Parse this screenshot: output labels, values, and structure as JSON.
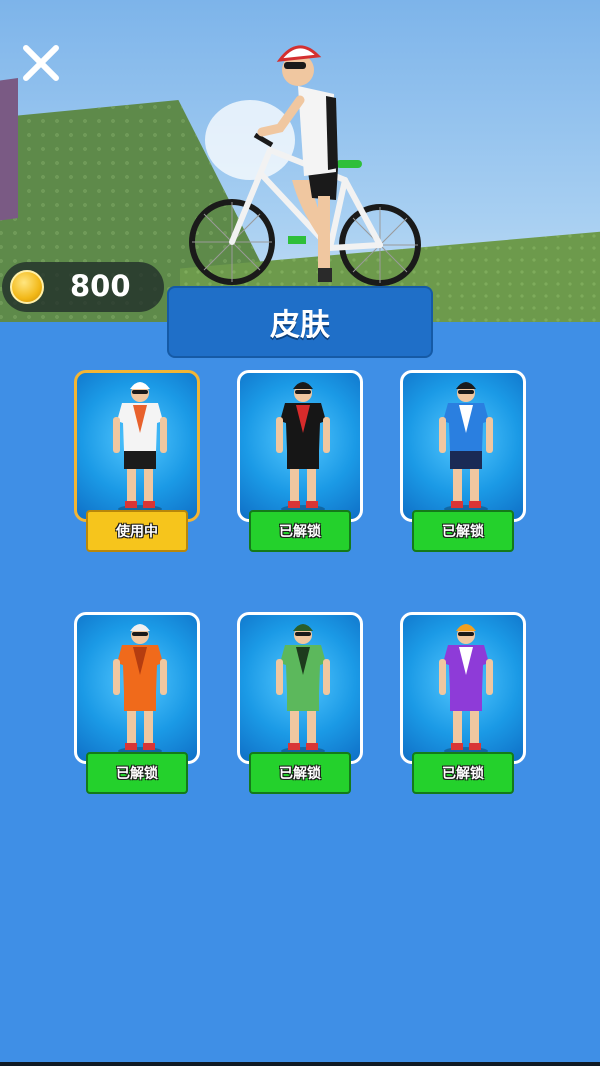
{
  "currency": {
    "amount": "800",
    "icon": "coin-icon"
  },
  "title": "皮肤",
  "colors": {
    "panel": "#3f8fe6",
    "tab": "#1f6fc8",
    "unlocked": "#24d12c",
    "in_use": "#f6c51c",
    "selected_border": "#f3b534"
  },
  "skins": [
    {
      "status": "使用中",
      "jersey": "#f4f4f4",
      "accent": "#e8612c",
      "shorts": "#1b1b1b",
      "helmet": "#ffffff",
      "selected": true
    },
    {
      "status": "已解锁",
      "jersey": "#161616",
      "accent": "#d72b2b",
      "shorts": "#161616",
      "helmet": "#1b1b1b",
      "selected": false
    },
    {
      "status": "已解锁",
      "jersey": "#2a7fe0",
      "accent": "#ffffff",
      "shorts": "#1a2a55",
      "helmet": "#1b1b1b",
      "selected": false
    },
    {
      "status": "已解锁",
      "jersey": "#f06a1b",
      "accent": "#b53d10",
      "shorts": "#f06a1b",
      "helmet": "#f0f0f0",
      "selected": false
    },
    {
      "status": "已解锁",
      "jersey": "#5cb85c",
      "accent": "#1d3b1d",
      "shorts": "#5cb85c",
      "helmet": "#2a5e2a",
      "selected": false
    },
    {
      "status": "已解锁",
      "jersey": "#8e3bd8",
      "accent": "#ffffff",
      "shorts": "#8e3bd8",
      "helmet": "#f2a020",
      "selected": false
    }
  ]
}
